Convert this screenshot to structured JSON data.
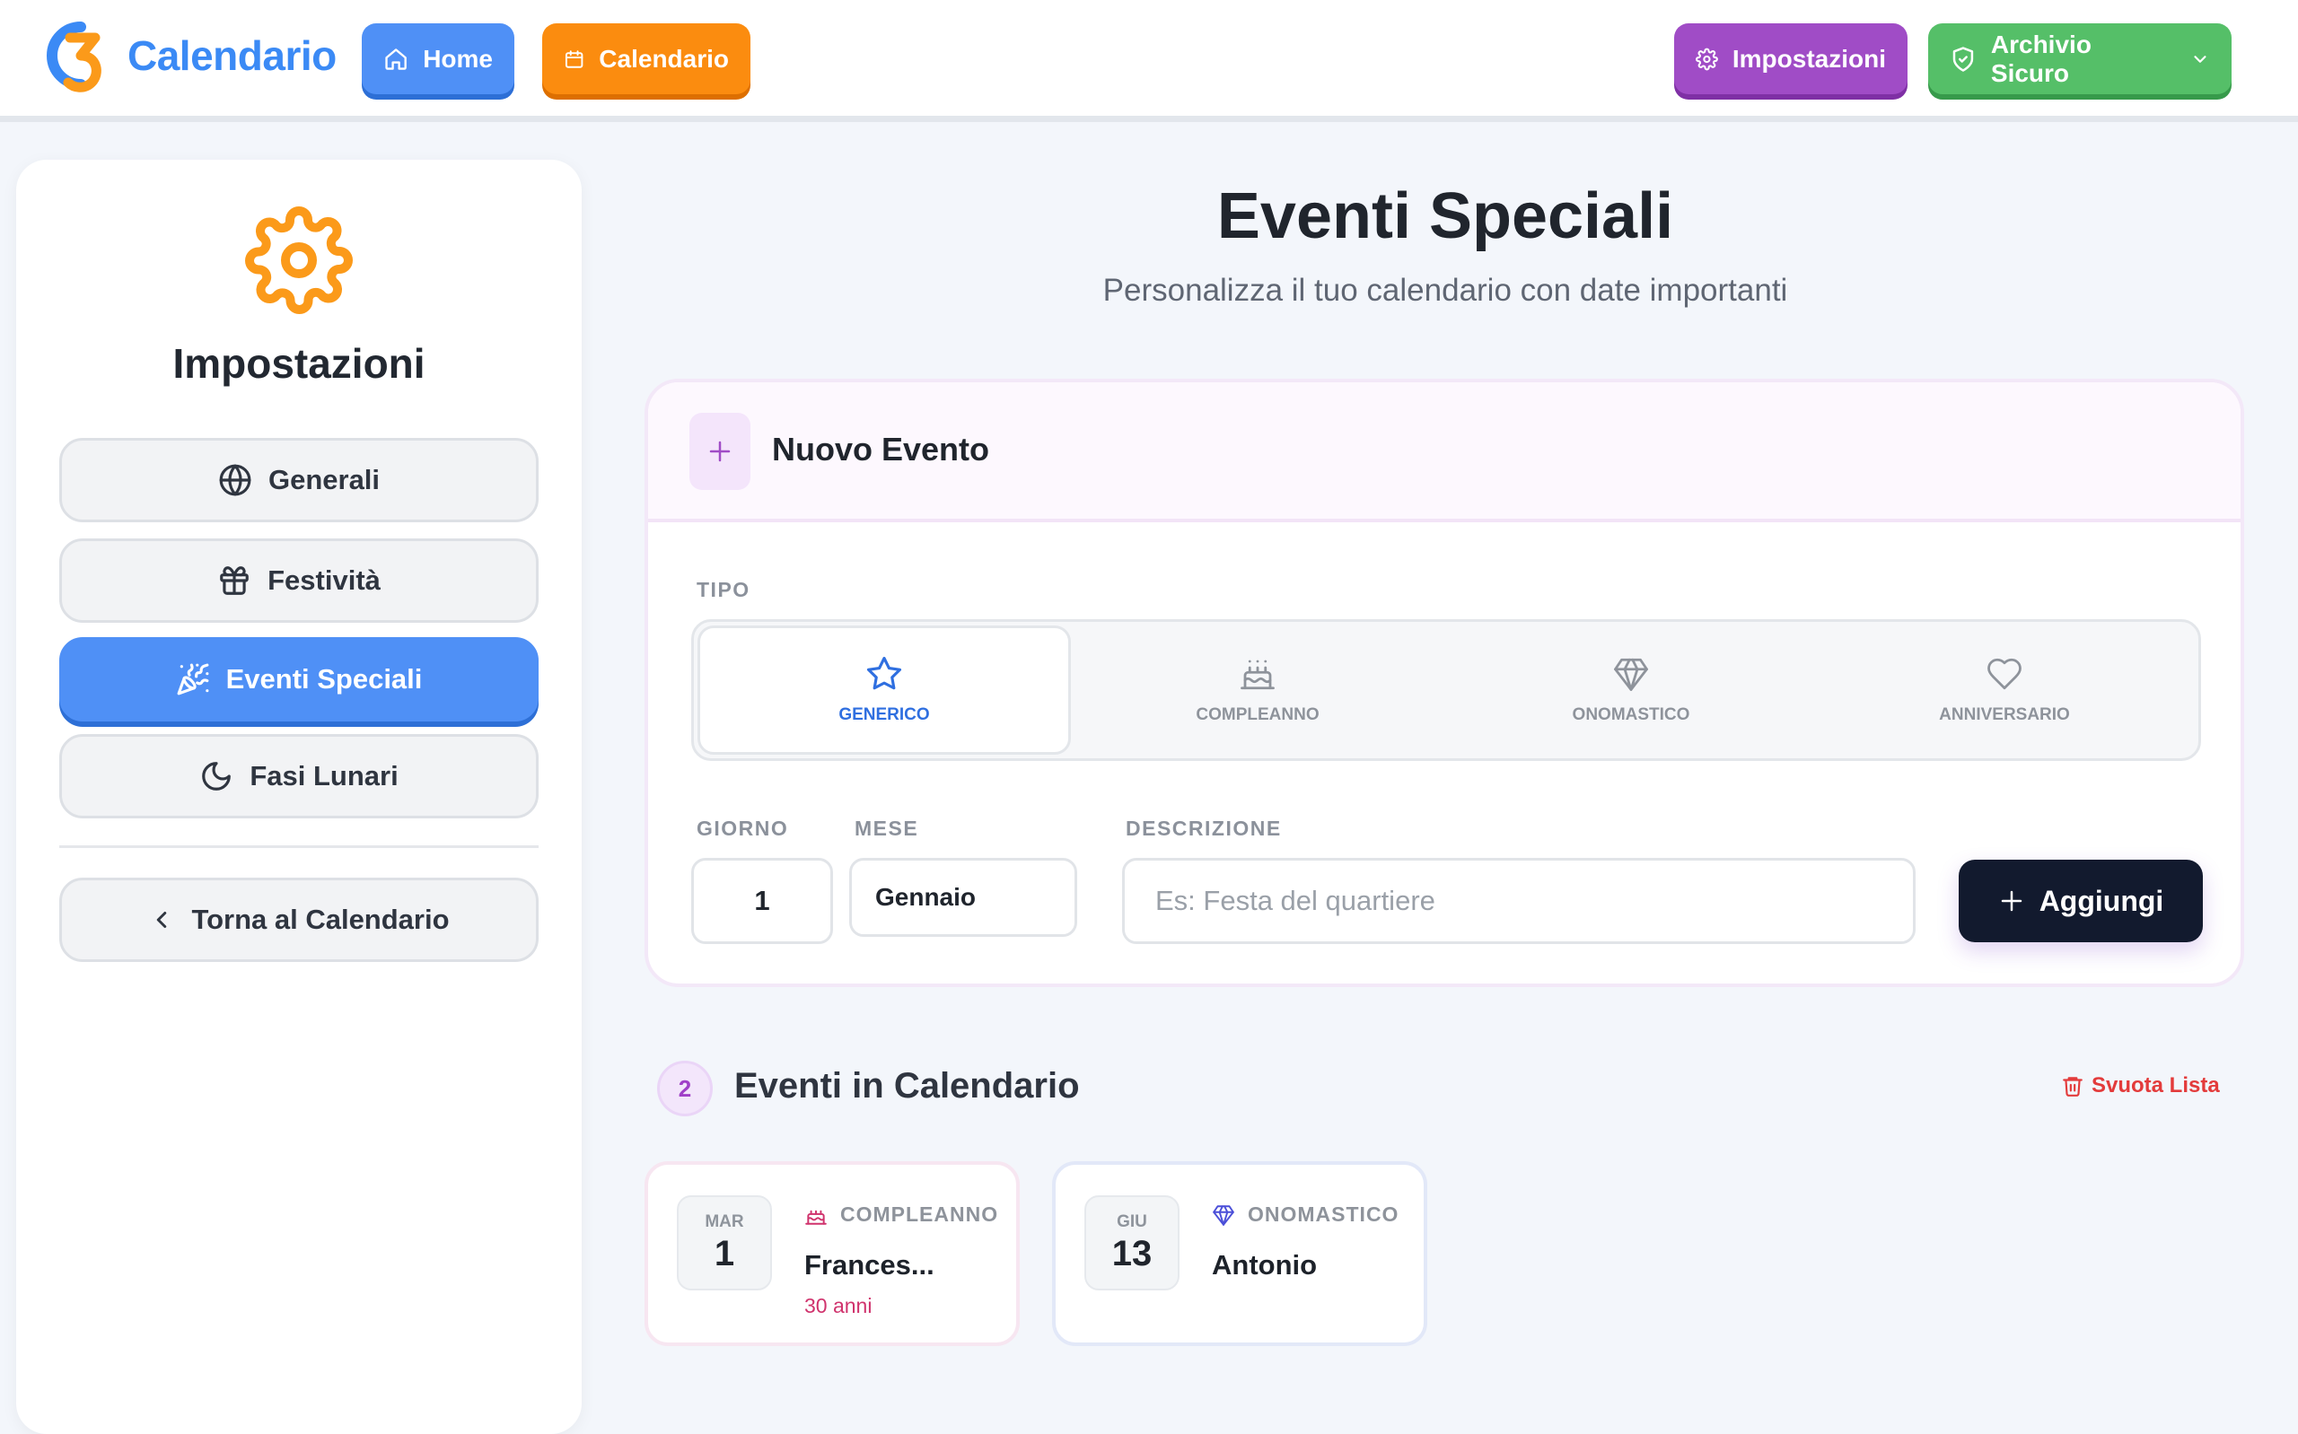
{
  "app": {
    "logo_text": "Calendario"
  },
  "nav": {
    "home": "Home",
    "calendar": "Calendario",
    "settings": "Impostazioni",
    "archive": "Archivio Sicuro"
  },
  "sidebar": {
    "title": "Impostazioni",
    "items": [
      {
        "label": "Generali",
        "icon": "globe-icon"
      },
      {
        "label": "Festività",
        "icon": "gift-icon"
      },
      {
        "label": "Eventi Speciali",
        "icon": "party-popper-icon",
        "active": true
      },
      {
        "label": "Fasi Lunari",
        "icon": "moon-icon"
      }
    ],
    "back": "Torna al Calendario"
  },
  "main": {
    "title": "Eventi Speciali",
    "subtitle": "Personalizza il tuo calendario con date importanti"
  },
  "new_event": {
    "title": "Nuovo Evento",
    "type_label": "TIPO",
    "types": [
      {
        "label": "GENERICO",
        "icon": "star-icon",
        "selected": true
      },
      {
        "label": "COMPLEANNO",
        "icon": "cake-icon"
      },
      {
        "label": "ONOMASTICO",
        "icon": "gem-icon"
      },
      {
        "label": "ANNIVERSARIO",
        "icon": "heart-icon"
      }
    ],
    "day_label": "GIORNO",
    "day_value": "1",
    "month_label": "MESE",
    "month_value": "Gennaio",
    "desc_label": "DESCRIZIONE",
    "desc_placeholder": "Es: Festa del quartiere",
    "add_button": "Aggiungi"
  },
  "events_list": {
    "count": "2",
    "title": "Eventi in Calendario",
    "clear": "Svuota Lista",
    "items": [
      {
        "month": "MAR",
        "day": "1",
        "type": "COMPLEANNO",
        "name": "Frances...",
        "sub": "30 anni"
      },
      {
        "month": "GIU",
        "day": "13",
        "type": "ONOMASTICO",
        "name": "Antonio"
      }
    ]
  },
  "colors": {
    "accent_blue": "#4f90f6",
    "accent_orange": "#fb8c0f",
    "accent_purple": "#a04cc6",
    "accent_green": "#55bf68",
    "dark_button": "#121a2e",
    "danger": "#e33b3b"
  }
}
